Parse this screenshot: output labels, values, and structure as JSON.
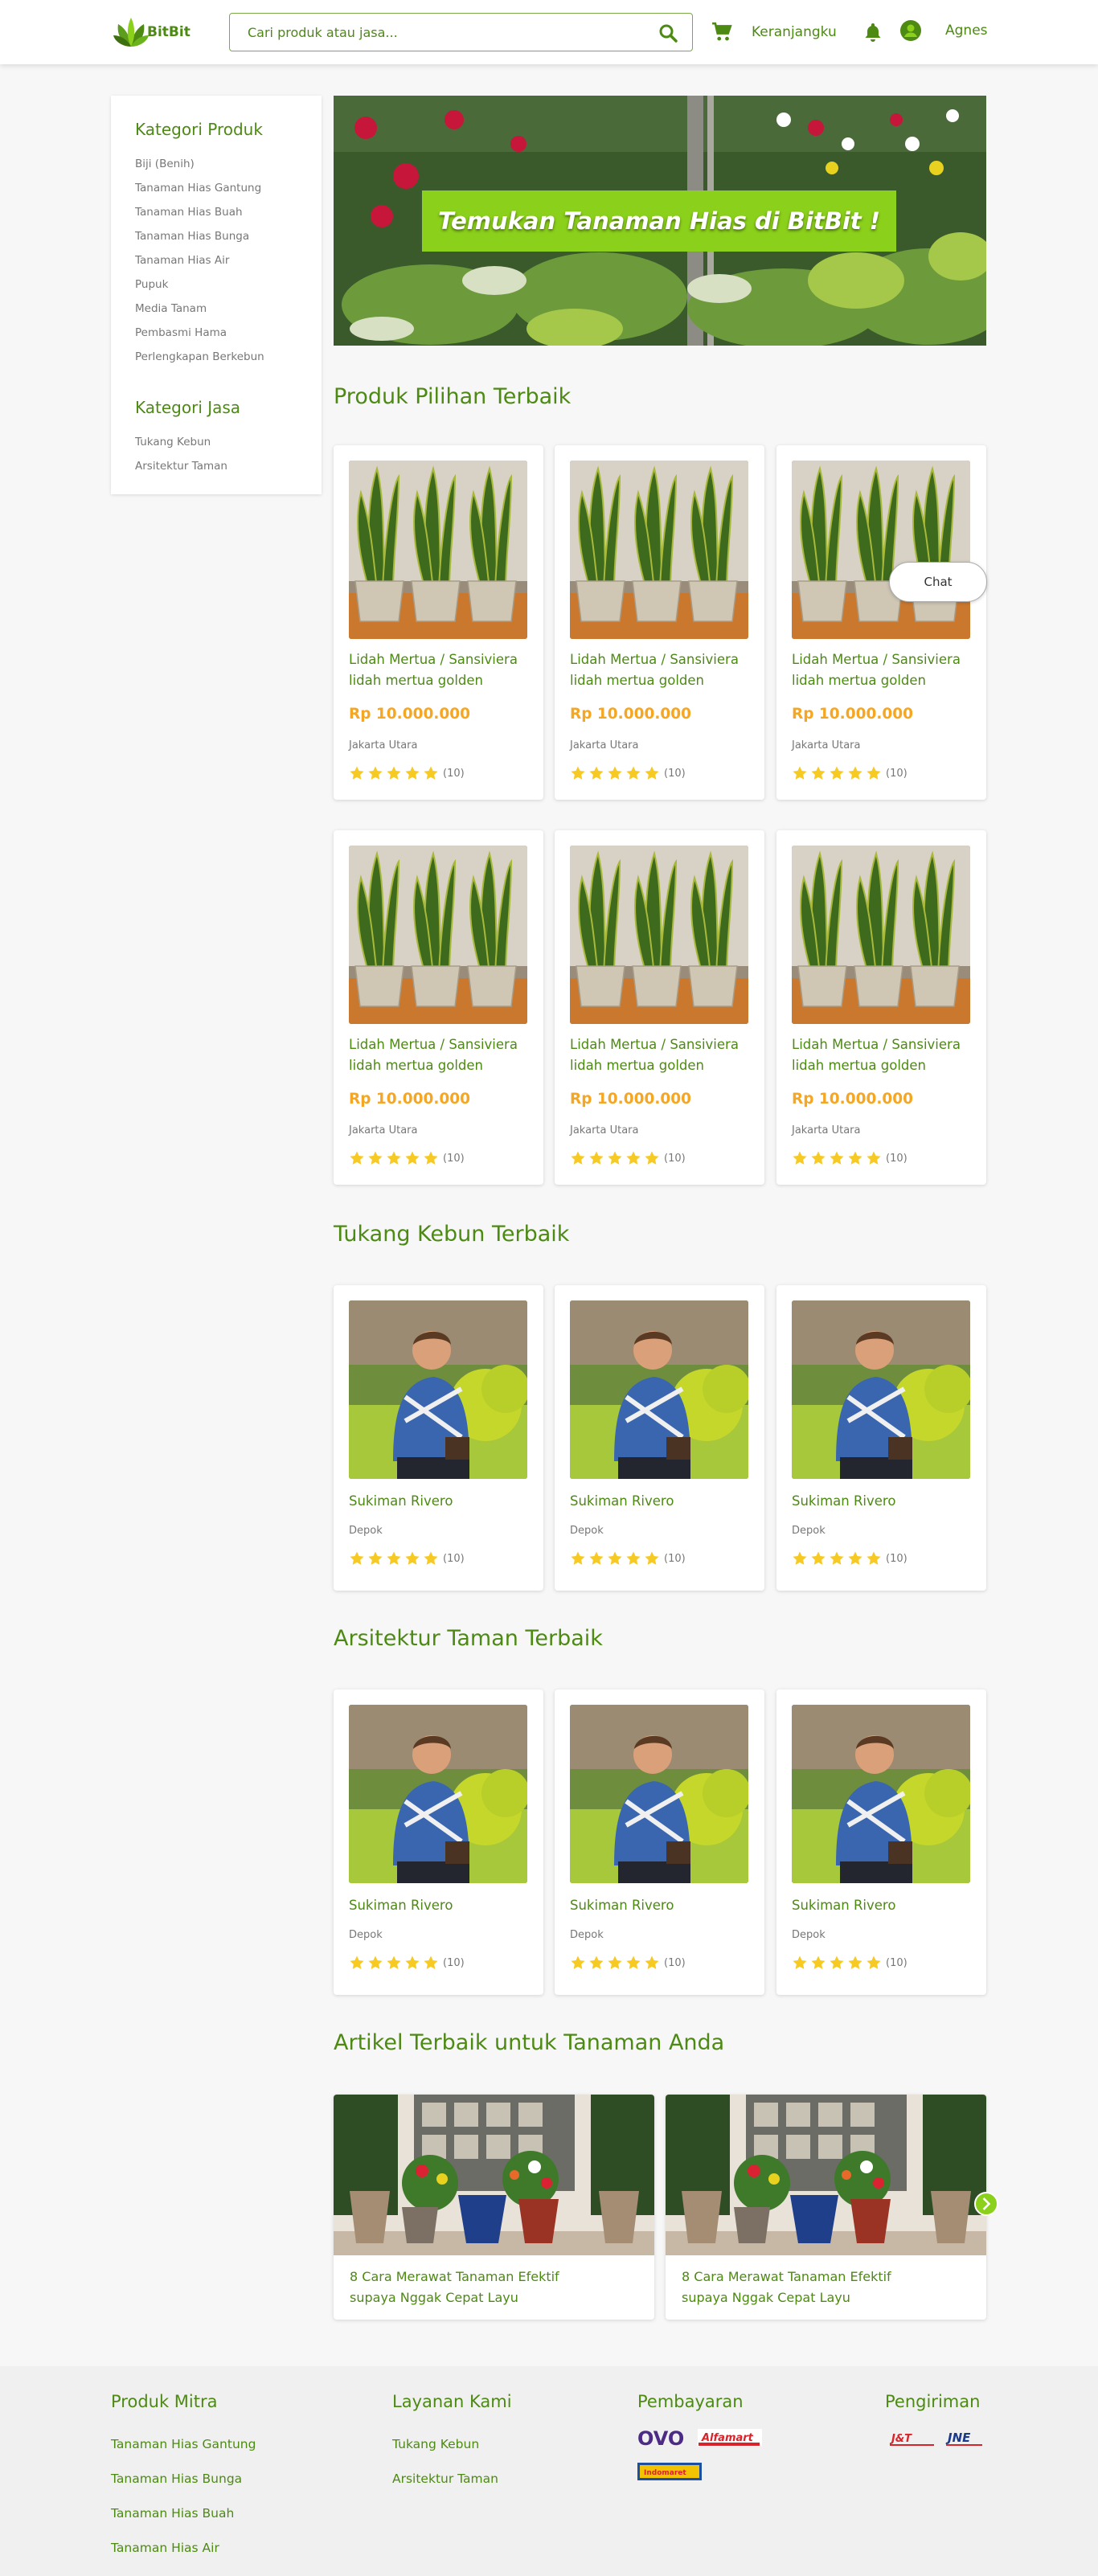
{
  "header": {
    "brand": "BitBit",
    "search_placeholder": "Cari produk atau jasa...",
    "cart_label": "Keranjangku",
    "user_name": "Agnes"
  },
  "sidebar": {
    "product_title": "Kategori Produk",
    "product_items": [
      "Biji (Benih)",
      "Tanaman Hias Gantung",
      "Tanaman Hias Buah",
      "Tanaman Hias Bunga",
      "Tanaman Hias Air",
      "Pupuk",
      "Media Tanam",
      "Pembasmi Hama",
      "Perlengkapan Berkebun"
    ],
    "service_title": "Kategori Jasa",
    "service_items": [
      "Tukang Kebun",
      "Arsitektur Taman"
    ]
  },
  "banner": {
    "text": "Temukan Tanaman Hias di BitBit !"
  },
  "sections": {
    "products": "Produk Pilihan Terbaik",
    "gardeners": "Tukang Kebun Terbaik",
    "architects": "Arsitektur Taman Terbaik",
    "articles": "Artikel Terbaik untuk Tanaman Anda"
  },
  "product": {
    "name": "Lidah Mertua / Sansiviera lidah mertua golden",
    "price": "Rp 10.000.000",
    "location": "Jakarta Utara",
    "reviews": "(10)",
    "rating": 5
  },
  "person": {
    "name": "Sukiman Rivero",
    "location": "Depok",
    "reviews": "(10)",
    "rating": 5
  },
  "chat_label": "Chat",
  "article": {
    "title": "8 Cara Merawat Tanaman Efektif supaya Nggak Cepat Layu"
  },
  "footer": {
    "partner_title": "Produk Mitra",
    "partner_items": [
      "Tanaman Hias Gantung",
      "Tanaman Hias Bunga",
      "Tanaman Hias Buah",
      "Tanaman Hias Air"
    ],
    "service_title": "Layanan Kami",
    "service_items": [
      "Tukang Kebun",
      "Arsitektur Taman"
    ],
    "payment_title": "Pembayaran",
    "payment_logos": [
      "OVO",
      "Alfamart",
      "Indomaret"
    ],
    "shipping_title": "Pengiriman",
    "shipping_logos": [
      "J&T",
      "JNE"
    ]
  },
  "colors": {
    "brand_green": "#4d8a13",
    "accent_lime": "#8bd01a",
    "price_orange": "#f5a623",
    "star": "#f7c923"
  }
}
